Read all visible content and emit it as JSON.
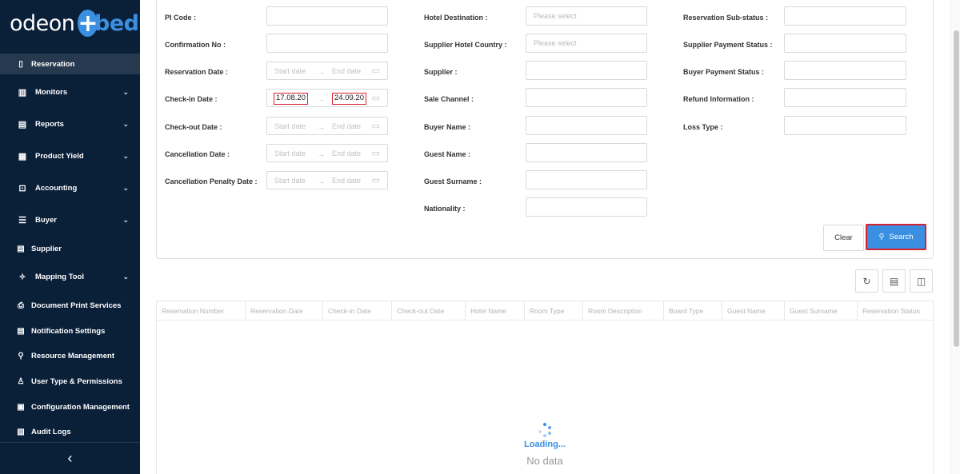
{
  "app": {
    "logo_part1": "odeon",
    "logo_plus": "+",
    "logo_part2": "beds"
  },
  "sidebar": {
    "items": [
      {
        "label": "Reservation",
        "icon": "document-icon",
        "active": true
      },
      {
        "label": "Monitors",
        "icon": "bar-chart-icon"
      },
      {
        "label": "Reports",
        "icon": "book-icon"
      },
      {
        "label": "Product Yield",
        "icon": "report-icon"
      },
      {
        "label": "Accounting",
        "icon": "accounting-icon"
      },
      {
        "label": "Buyer",
        "icon": "list-icon"
      },
      {
        "label": "Supplier",
        "icon": "building-icon"
      },
      {
        "label": "Mapping Tool",
        "icon": "pin-icon"
      },
      {
        "label": "Document Print Services",
        "icon": "printer-icon"
      },
      {
        "label": "Notification Settings",
        "icon": "notification-icon"
      },
      {
        "label": "Resource Management",
        "icon": "search-icon"
      },
      {
        "label": "User Type & Permissions",
        "icon": "user-icon"
      },
      {
        "label": "Configuration Management",
        "icon": "config-icon"
      },
      {
        "label": "Audit Logs",
        "icon": "log-icon"
      }
    ],
    "collapse_icon": "‹"
  },
  "form": {
    "col1": [
      {
        "label": "PI Code :"
      },
      {
        "label": "Confirmation No :"
      },
      {
        "label": "Reservation Date :",
        "start": "Start date",
        "end": "End date"
      },
      {
        "label": "Check-in Date :",
        "start_value": "17.08.20",
        "end_value": "24.09.20"
      },
      {
        "label": "Check-out Date :",
        "start": "Start date",
        "end": "End date"
      },
      {
        "label": "Cancellation Date :",
        "start": "Start date",
        "end": "End date"
      },
      {
        "label": "Cancellation Penalty Date :",
        "start": "Start date",
        "end": "End date"
      }
    ],
    "col2": [
      {
        "label": "Hotel Destination :",
        "placeholder": "Please select"
      },
      {
        "label": "Supplier Hotel Country :",
        "placeholder": "Please select"
      },
      {
        "label": "Supplier :"
      },
      {
        "label": "Sale Channel :"
      },
      {
        "label": "Buyer Name :"
      },
      {
        "label": "Guest Name :"
      },
      {
        "label": "Guest Surname :"
      },
      {
        "label": "Nationality :"
      }
    ],
    "col3": [
      {
        "label": "Reservation Sub-status :"
      },
      {
        "label": "Supplier Payment Status :"
      },
      {
        "label": "Buyer Payment Status :"
      },
      {
        "label": "Refund Information :"
      },
      {
        "label": "Loss Type :"
      }
    ],
    "clear_label": "Clear",
    "search_label": "Search"
  },
  "table": {
    "columns": [
      "Reservation Number",
      "Reservation Date",
      "Check-in Date",
      "Check-out Date",
      "Hotel Name",
      "Room Type",
      "Room Description",
      "Board Type",
      "Guest Name",
      "Guest Surname",
      "Reservation Status"
    ],
    "loading_text": "Loading...",
    "empty_text": "No data"
  },
  "colors": {
    "accent": "#3b8fe0",
    "sidebar": "#0a1f38",
    "highlight": "#d92030"
  }
}
